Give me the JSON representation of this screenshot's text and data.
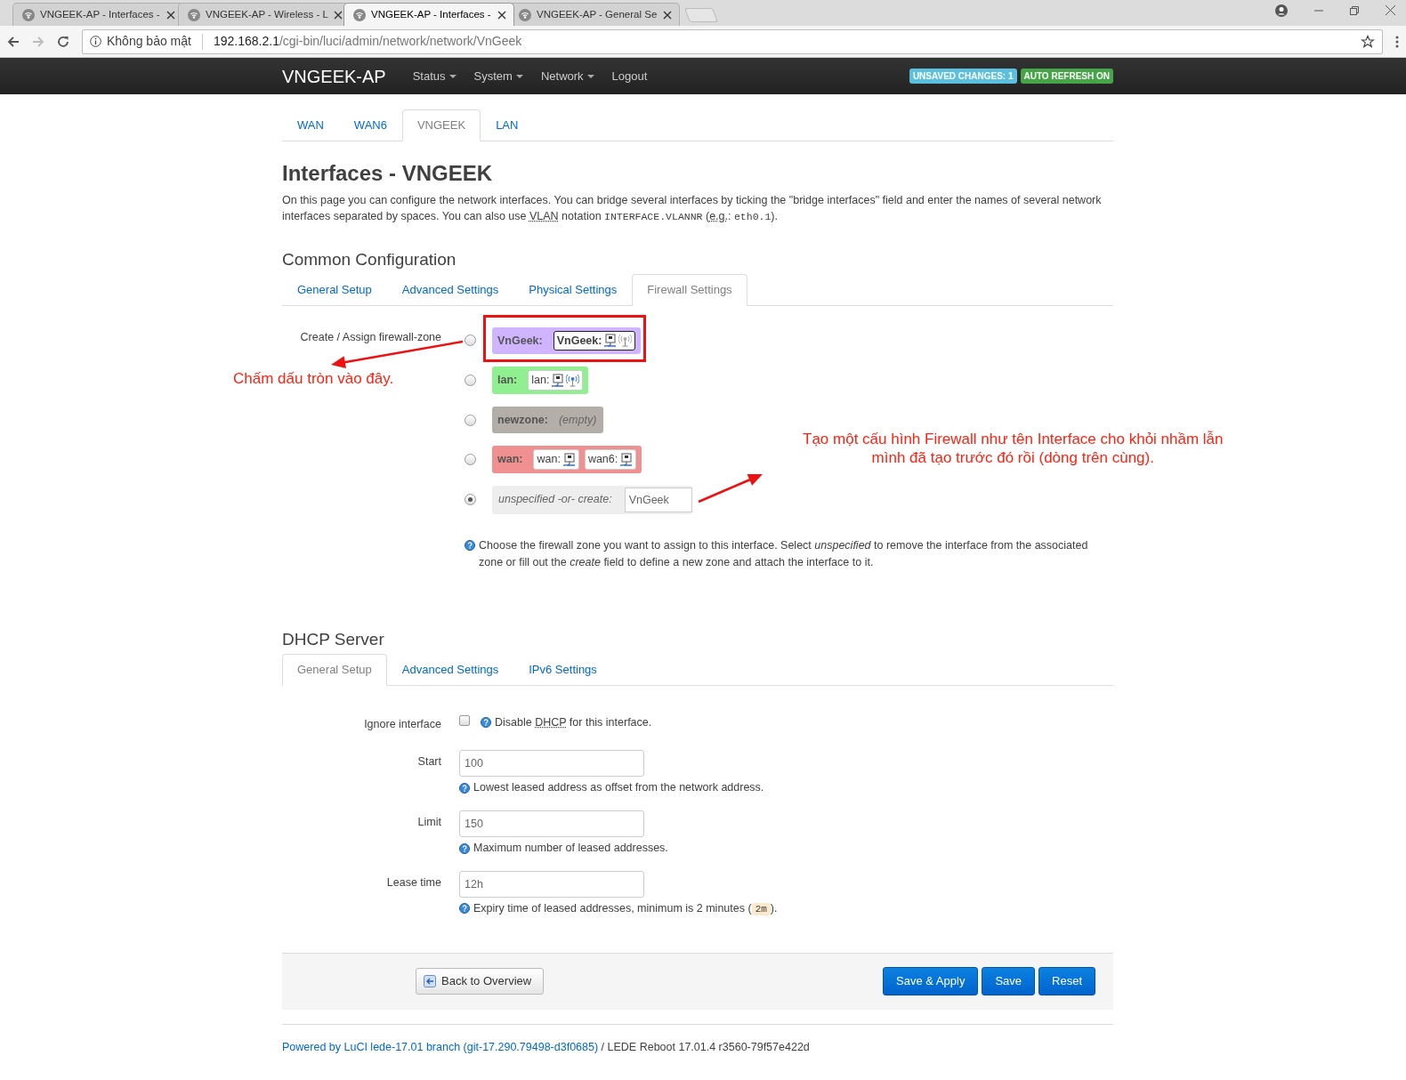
{
  "browser": {
    "tabs": [
      {
        "title": "VNGEEK-AP - Interfaces -",
        "selected": false
      },
      {
        "title": "VNGEEK-AP - Wireless - L",
        "selected": false
      },
      {
        "title": "VNGEEK-AP - Interfaces -",
        "selected": true
      },
      {
        "title": "VNGEEK-AP - General Se",
        "selected": false
      }
    ],
    "address": {
      "security": "Không bảo mật",
      "host": "192.168.2.1",
      "path": "/cgi-bin/luci/admin/network/network/VnGeek"
    }
  },
  "navbar": {
    "brand": "VNGEEK-AP",
    "menus": [
      {
        "label": "Status",
        "dropdown": true
      },
      {
        "label": "System",
        "dropdown": true
      },
      {
        "label": "Network",
        "dropdown": true
      },
      {
        "label": "Logout",
        "dropdown": false
      }
    ],
    "badges": [
      {
        "text": "UNSAVED CHANGES: 1",
        "color": "#5bc0de"
      },
      {
        "text": "AUTO REFRESH ON",
        "color": "#46a546"
      }
    ]
  },
  "interface_tabs": [
    {
      "label": "WAN",
      "selected": false
    },
    {
      "label": "WAN6",
      "selected": false
    },
    {
      "label": "VNGEEK",
      "selected": true
    },
    {
      "label": "LAN",
      "selected": false
    }
  ],
  "title": "Interfaces - VNGEEK",
  "description": [
    {
      "kind": "text",
      "text": "On this page you can configure the network interfaces. You can bridge several interfaces by ticking the \"bridge interfaces\" field and enter the names of several network interfaces separated by spaces. You can also use "
    },
    {
      "kind": "abbr",
      "text": "VLAN"
    },
    {
      "kind": "text",
      "text": " notation "
    },
    {
      "kind": "code",
      "text": "INTERFACE.VLANNR"
    },
    {
      "kind": "text",
      "text": " ("
    },
    {
      "kind": "abbr",
      "text": "e.g."
    },
    {
      "kind": "text",
      "text": ": "
    },
    {
      "kind": "code",
      "text": "eth0.1"
    },
    {
      "kind": "text",
      "text": ")."
    }
  ],
  "common": {
    "heading": "Common Configuration",
    "tabs": [
      {
        "label": "General Setup",
        "selected": false
      },
      {
        "label": "Advanced Settings",
        "selected": false
      },
      {
        "label": "Physical Settings",
        "selected": false
      },
      {
        "label": "Firewall Settings",
        "selected": true
      }
    ],
    "field_label": "Create / Assign firewall-zone",
    "zones": [
      {
        "kind": "zone",
        "name": "VnGeek:",
        "color": "#d0b4ff",
        "selected": false,
        "networks": [
          {
            "label": "VnGeek:",
            "active": true,
            "devices": [
              {
                "kind": "ethernet"
              },
              {
                "kind": "wifi",
                "up": false
              }
            ]
          }
        ]
      },
      {
        "kind": "zone",
        "name": "lan:",
        "color": "#90f090",
        "selected": false,
        "networks": [
          {
            "label": "lan:",
            "active": false,
            "devices": [
              {
                "kind": "ethernet"
              },
              {
                "kind": "wifi",
                "up": true
              }
            ]
          }
        ]
      },
      {
        "kind": "empty",
        "name": "newzone:",
        "color": "#b4aea8",
        "selected": false,
        "empty": "(empty)"
      },
      {
        "kind": "zone",
        "name": "wan:",
        "color": "#f09090",
        "selected": false,
        "networks": [
          {
            "label": "wan:",
            "active": false,
            "devices": [
              {
                "kind": "ethernet"
              }
            ]
          },
          {
            "label": "wan6:",
            "active": false,
            "devices": [
              {
                "kind": "ethernet"
              }
            ]
          }
        ]
      },
      {
        "kind": "create",
        "name": "unspecified -or- create:",
        "color": "#eeeeee",
        "selected": true,
        "value": "VnGeek"
      }
    ],
    "help": "Choose the firewall zone you want to assign to this interface. Select *unspecified* to remove the interface from the associated zone or fill out the *create* field to define a new zone and attach the interface to it."
  },
  "dhcp": {
    "heading": "DHCP Server",
    "tabs": [
      {
        "label": "General Setup",
        "selected": true
      },
      {
        "label": "Advanced Settings",
        "selected": false
      },
      {
        "label": "IPv6 Settings",
        "selected": false
      }
    ],
    "fields": [
      {
        "kind": "checkbox",
        "label": "Ignore interface",
        "checked": false,
        "help": [
          {
            "kind": "text",
            "text": "Disable "
          },
          {
            "kind": "abbr",
            "text": "DHCP"
          },
          {
            "kind": "text",
            "text": " for this interface."
          }
        ]
      },
      {
        "kind": "input",
        "label": "Start",
        "value": "100",
        "help": [
          {
            "kind": "text",
            "text": "Lowest leased address as offset from the network address."
          }
        ]
      },
      {
        "kind": "input",
        "label": "Limit",
        "value": "150",
        "help": [
          {
            "kind": "text",
            "text": "Maximum number of leased addresses."
          }
        ]
      },
      {
        "kind": "input",
        "label": "Lease time",
        "value": "12h",
        "help": [
          {
            "kind": "text",
            "text": "Expiry time of leased addresses, minimum is 2 minutes ("
          },
          {
            "kind": "code",
            "text": "2m"
          },
          {
            "kind": "text",
            "text": ")."
          }
        ]
      }
    ]
  },
  "actions": {
    "back": "Back to Overview",
    "buttons": [
      "Save & Apply",
      "Save",
      "Reset"
    ]
  },
  "footer": {
    "link": "Powered by LuCI lede-17.01 branch (git-17.290.79498-d3f0685)",
    "text": " / LEDE Reboot 17.01.4 r3560-79f57e422d"
  },
  "annotations": [
    {
      "kind": "frame"
    },
    {
      "kind": "arrow"
    },
    {
      "kind": "note",
      "text": "Chấm dấu tròn vào đây."
    },
    {
      "kind": "note",
      "text": "Tạo một cấu hình Firewall như tên Interface cho khỏi nhầm lẫn\nmình đã tạo trước đó rồi (dòng trên cùng)."
    },
    {
      "kind": "arrow"
    }
  ]
}
